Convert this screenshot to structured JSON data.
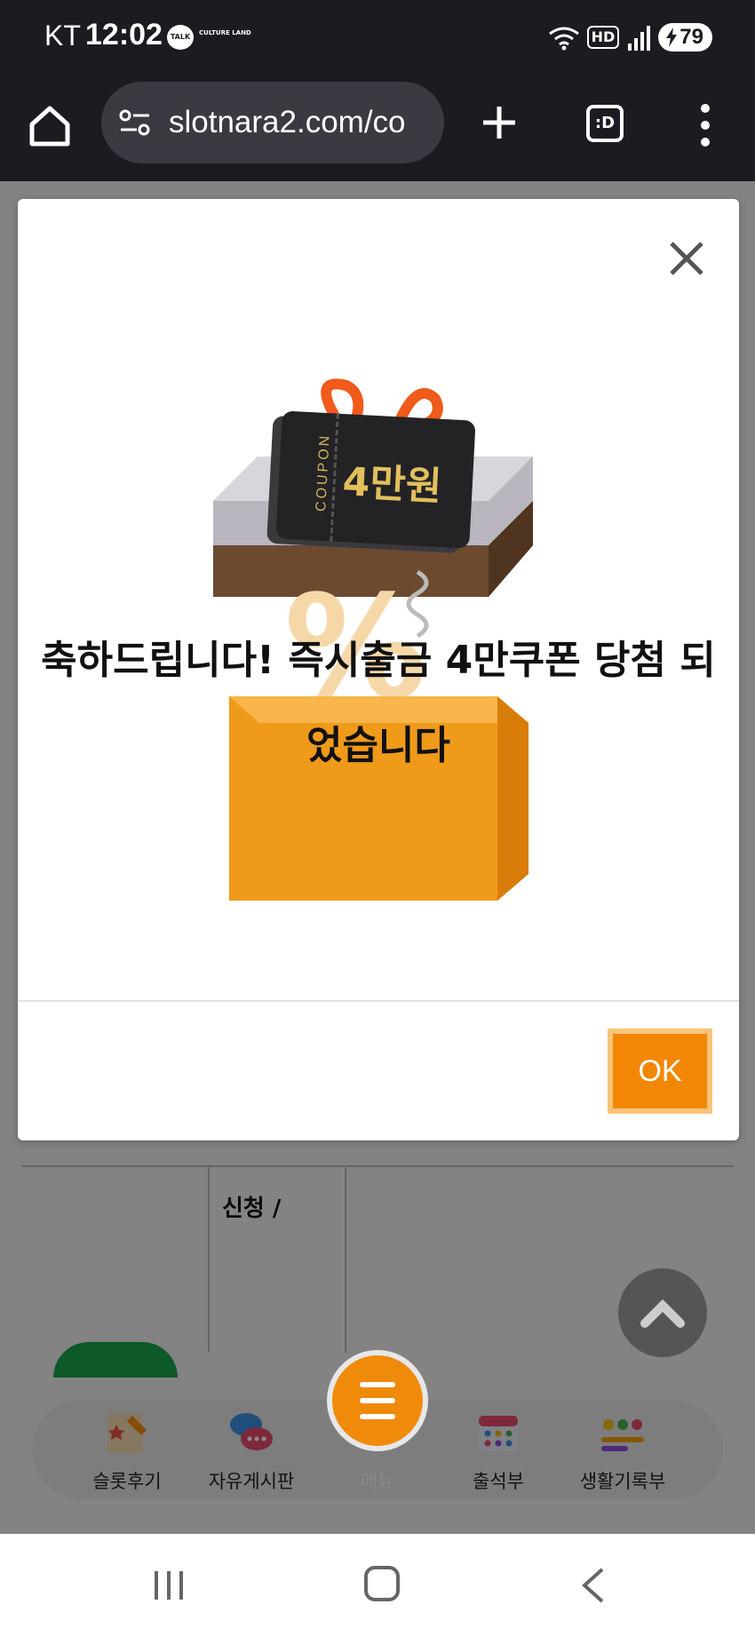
{
  "status_bar": {
    "carrier": "KT",
    "time": "12:02",
    "talk_badge": "TALK",
    "culture_badge": "CULTURE LAND",
    "hd": "HD",
    "battery": "79"
  },
  "browser": {
    "url": "slotnara2.com/co",
    "tabs_label": ":D"
  },
  "modal": {
    "coupon_side_text": "COUPON",
    "coupon_amount": "4만원",
    "headline": "축하드립니다! 즉시출금 4만쿠폰 당첨 되었습니다",
    "ok_label": "OK"
  },
  "page_behind": {
    "table_text": "신청 /"
  },
  "bottom_nav": {
    "items": [
      {
        "label": "슬롯후기",
        "icon": "review-icon"
      },
      {
        "label": "자유게시판",
        "icon": "chat-bubbles-icon"
      },
      {
        "label": "메뉴",
        "icon": "menu-icon"
      },
      {
        "label": "출석부",
        "icon": "calendar-icon"
      },
      {
        "label": "생활기록부",
        "icon": "emoji-record-icon"
      }
    ]
  },
  "colors": {
    "accent": "#f28705",
    "dark_bar": "#1b1b22"
  }
}
